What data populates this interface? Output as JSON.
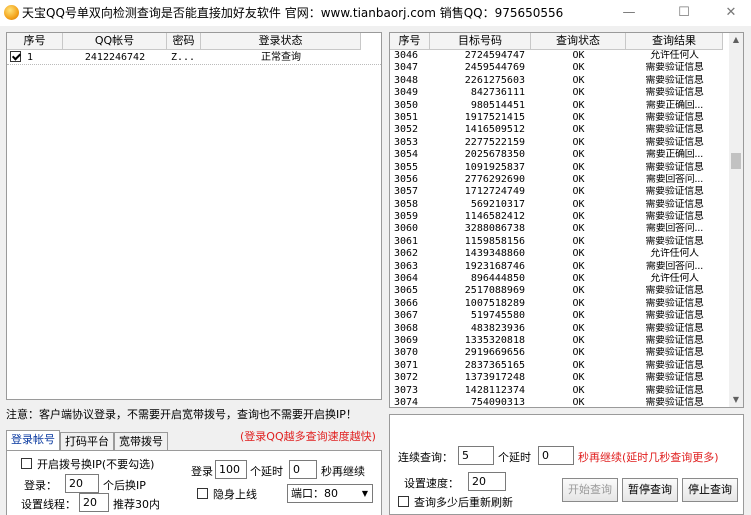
{
  "window": {
    "title": "天宝QQ号单双向检测查询是否能直接加好友软件  官网：www.tianbaorj.com  销售QQ：975650556",
    "controls": {
      "minimize": "—",
      "maximize": "☐",
      "close": "✕"
    }
  },
  "accounts_table": {
    "columns": [
      "序号",
      "QQ帐号",
      "密码",
      "登录状态"
    ],
    "rows": [
      {
        "checked": true,
        "seq": "1",
        "qq": "2412246742",
        "pwd": "Z...",
        "status": "正常查询"
      }
    ]
  },
  "results_table": {
    "columns": [
      "序号",
      "目标号码",
      "查询状态",
      "查询结果"
    ],
    "rows": [
      [
        "3046",
        "2724594747",
        "OK",
        "允许任何人"
      ],
      [
        "3047",
        "2459544769",
        "OK",
        "需要验证信息"
      ],
      [
        "3048",
        "2261275603",
        "OK",
        "需要验证信息"
      ],
      [
        "3049",
        "842736111",
        "OK",
        "需要验证信息"
      ],
      [
        "3050",
        "980514451",
        "OK",
        "需要正确回..."
      ],
      [
        "3051",
        "1917521415",
        "OK",
        "需要验证信息"
      ],
      [
        "3052",
        "1416509512",
        "OK",
        "需要验证信息"
      ],
      [
        "3053",
        "2277522159",
        "OK",
        "需要验证信息"
      ],
      [
        "3054",
        "2025678350",
        "OK",
        "需要正确回..."
      ],
      [
        "3055",
        "1091925837",
        "OK",
        "需要验证信息"
      ],
      [
        "3056",
        "2776292690",
        "OK",
        "需要回答问..."
      ],
      [
        "3057",
        "1712724749",
        "OK",
        "需要验证信息"
      ],
      [
        "3058",
        "569210317",
        "OK",
        "需要验证信息"
      ],
      [
        "3059",
        "1146582412",
        "OK",
        "需要验证信息"
      ],
      [
        "3060",
        "3288086738",
        "OK",
        "需要回答问..."
      ],
      [
        "3061",
        "1159858156",
        "OK",
        "需要验证信息"
      ],
      [
        "3062",
        "1439348860",
        "OK",
        "允许任何人"
      ],
      [
        "3063",
        "1923168746",
        "OK",
        "需要回答问..."
      ],
      [
        "3064",
        "896444850",
        "OK",
        "允许任何人"
      ],
      [
        "3065",
        "2517088969",
        "OK",
        "需要验证信息"
      ],
      [
        "3066",
        "1007518289",
        "OK",
        "需要验证信息"
      ],
      [
        "3067",
        "519745580",
        "OK",
        "需要验证信息"
      ],
      [
        "3068",
        "483823936",
        "OK",
        "需要验证信息"
      ],
      [
        "3069",
        "1335320818",
        "OK",
        "需要验证信息"
      ],
      [
        "3070",
        "2919669656",
        "OK",
        "需要验证信息"
      ],
      [
        "3071",
        "2837365165",
        "OK",
        "需要验证信息"
      ],
      [
        "3072",
        "1373917248",
        "OK",
        "需要验证信息"
      ],
      [
        "3073",
        "1428112374",
        "OK",
        "需要验证信息"
      ],
      [
        "3074",
        "754090313",
        "OK",
        "需要验证信息"
      ]
    ]
  },
  "notice": "注意：客户端协议登录，不需要开启宽带拨号，查询也不需要开启换IP！",
  "tabs": [
    "登录帐号",
    "打码平台",
    "宽带拨号"
  ],
  "tip_red": "(登录QQ越多查询速度越快)",
  "login_panel": {
    "enable_ip_label": "开启拨号换IP(不要勾选)",
    "login_label": "登录：",
    "login_value": "20",
    "login_suffix": "个后换IP",
    "threads_label": "设置线程：",
    "threads_value": "20",
    "threads_suffix": "推荐30内",
    "login2_label": "登录",
    "login2_value": "100",
    "delay_label": "个延时",
    "delay_value": "0",
    "continue_label": "秒再继续",
    "invisible_label": "隐身上线",
    "port_label": "端口：80"
  },
  "query_panel": {
    "continuous_label": "连续查询：",
    "continuous_value": "5",
    "delay_label": "个延时",
    "delay_value": "0",
    "continue_label": "秒再继续(延时几秒查询更多)",
    "speed_label": "设置速度：",
    "speed_value": "20",
    "refresh_label": "查询多少后重新刷新",
    "start_button": "开始查询",
    "pause_button": "暂停查询",
    "stop_button": "停止查询"
  }
}
